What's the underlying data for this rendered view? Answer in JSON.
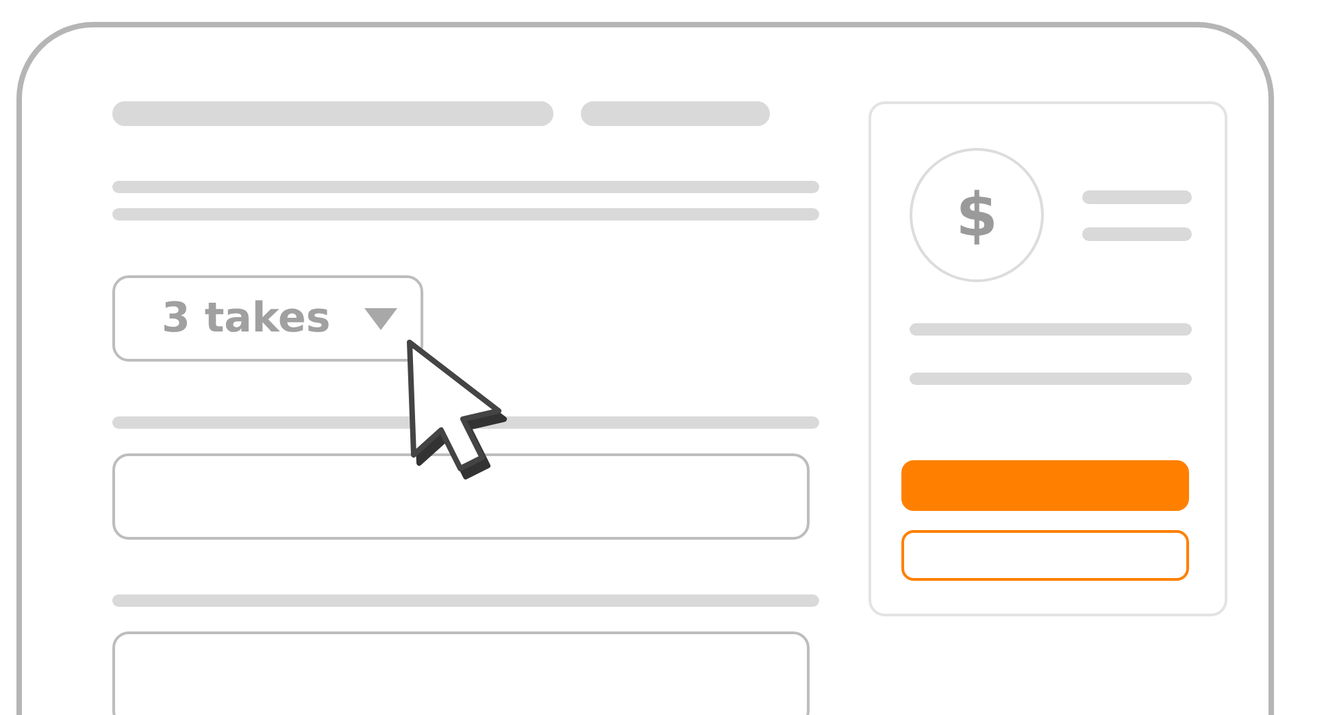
{
  "dropdown": {
    "value": "3 takes"
  },
  "price_card": {
    "currency_symbol": "$"
  }
}
